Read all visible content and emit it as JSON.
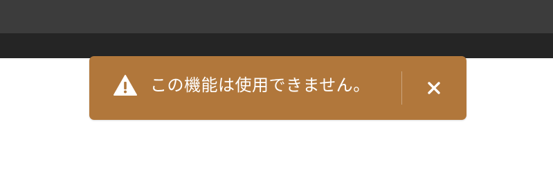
{
  "colors": {
    "toolbar": "#3c3c3c",
    "subbar": "#252525",
    "content": "#ffffff",
    "toast_background": "#b1773b",
    "toast_text": "#ffffff"
  },
  "toast": {
    "icon": "warning-triangle-icon",
    "message": "この機能は使用できません。",
    "close_icon": "close-icon"
  }
}
